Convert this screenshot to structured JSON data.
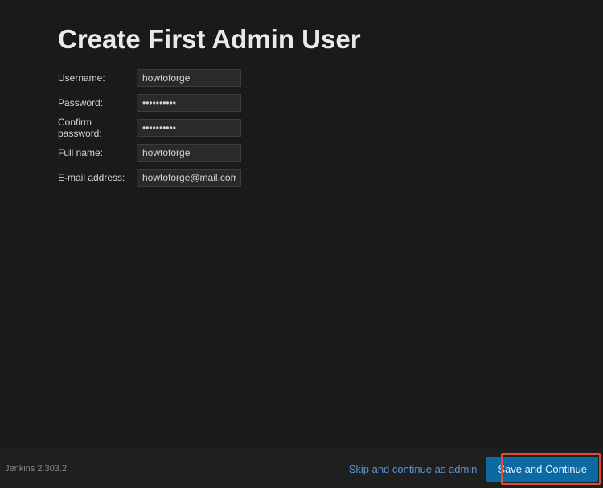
{
  "page": {
    "title": "Create First Admin User"
  },
  "form": {
    "username": {
      "label": "Username:",
      "value": "howtoforge"
    },
    "password": {
      "label": "Password:",
      "value": "••••••••••"
    },
    "confirm": {
      "label": "Confirm password:",
      "value": "••••••••••"
    },
    "fullname": {
      "label": "Full name:",
      "value": "howtoforge"
    },
    "email": {
      "label": "E-mail address:",
      "value": "howtoforge@mail.com"
    }
  },
  "footer": {
    "version": "Jenkins 2.303.2",
    "skip_label": "Skip and continue as admin",
    "save_label": "Save and Continue"
  }
}
